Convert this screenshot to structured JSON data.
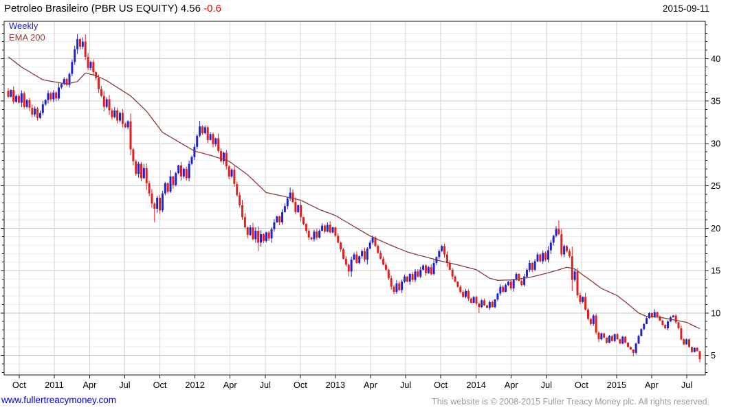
{
  "header": {
    "title_main": "Petroleo Brasileiro (PBR US EQUITY) 4.56 ",
    "title_change": "-0.6",
    "date": "2015-09-11"
  },
  "legend": {
    "weekly": "Weekly",
    "ema": "EMA 200"
  },
  "footer": {
    "site": "www.fullertreacymoney.com",
    "copyright": "This website is © 2008-2015 Fuller Treacy Money plc. All rights reserved."
  },
  "colors": {
    "up_candle": "#2222cc",
    "down_candle": "#e02020",
    "ema_line": "#8b3a3a",
    "change_text": "#e00000",
    "grid_minor": "#ececec",
    "grid_major": "#c9c9c9",
    "grid_vertical": "#d6d6d6",
    "axis": "#1a1a1a",
    "label_text": "#000000"
  },
  "chart_data": {
    "type": "candlestick",
    "interval": "weekly",
    "title": "Petroleo Brasileiro (PBR US EQUITY)",
    "last_price": 4.56,
    "change": -0.6,
    "as_of_date": "2015-09-11",
    "ylim": [
      2.7,
      44.4
    ],
    "y_major_ticks": [
      5,
      10,
      15,
      20,
      25,
      30,
      35,
      40
    ],
    "y_minor_step": 1,
    "y_minor_range": [
      3,
      44
    ],
    "x_tick_labels": [
      "Oct",
      "2011",
      "Apr",
      "Jul",
      "Oct",
      "2012",
      "Apr",
      "Jul",
      "Oct",
      "2013",
      "Apr",
      "Jul",
      "Oct",
      "2014",
      "Apr",
      "Jul",
      "Oct",
      "2015",
      "Apr",
      "Jul"
    ],
    "x_tick_weeks": [
      4.1,
      17.3,
      30.6,
      43.8,
      57.0,
      70.2,
      83.4,
      96.6,
      109.8,
      123.0,
      136.2,
      149.4,
      162.6,
      175.9,
      189.1,
      202.3,
      215.5,
      228.7,
      241.9,
      255.1
    ],
    "first_open": 36.2,
    "weekly_closes": [
      35.5,
      36.3,
      34.9,
      35.6,
      34.8,
      35.9,
      34.3,
      35.1,
      34.2,
      33.4,
      34.1,
      33.0,
      33.6,
      34.6,
      35.1,
      35.9,
      35.2,
      36.0,
      35.3,
      36.6,
      37.0,
      37.6,
      36.9,
      38.2,
      39.6,
      41.1,
      42.3,
      41.4,
      42.0,
      40.2,
      38.9,
      39.6,
      38.4,
      37.7,
      36.4,
      35.6,
      34.3,
      35.2,
      33.9,
      33.1,
      33.9,
      32.7,
      33.6,
      32.3,
      31.9,
      32.6,
      29.3,
      27.9,
      26.4,
      27.6,
      25.9,
      27.1,
      25.3,
      24.1,
      22.9,
      22.3,
      23.6,
      22.1,
      24.1,
      25.3,
      24.3,
      26.1,
      25.1,
      26.5,
      27.4,
      26.1,
      27.0,
      25.9,
      27.6,
      28.4,
      29.6,
      30.9,
      32.0,
      31.2,
      31.9,
      30.4,
      31.1,
      29.9,
      30.6,
      29.1,
      27.9,
      28.9,
      27.3,
      26.1,
      26.9,
      25.2,
      23.9,
      22.7,
      21.3,
      20.1,
      19.2,
      20.1,
      18.7,
      19.7,
      18.3,
      19.3,
      18.5,
      19.5,
      18.8,
      19.9,
      20.7,
      21.4,
      20.7,
      21.9,
      22.6,
      23.5,
      24.2,
      23.1,
      21.9,
      22.7,
      21.3,
      20.5,
      19.7,
      18.9,
      18.7,
      19.6,
      18.9,
      19.7,
      20.3,
      19.6,
      20.4,
      19.5,
      20.1,
      19.1,
      18.3,
      17.5,
      16.4,
      15.7,
      14.9,
      16.3,
      16.9,
      15.9,
      16.7,
      17.3,
      16.3,
      17.6,
      18.3,
      18.9,
      17.9,
      17.1,
      16.4,
      15.7,
      15.1,
      14.1,
      13.1,
      12.5,
      13.5,
      12.7,
      13.7,
      14.3,
      13.7,
      14.6,
      13.9,
      14.9,
      14.3,
      15.1,
      15.6,
      14.7,
      15.4,
      14.6,
      15.9,
      16.6,
      17.3,
      17.9,
      16.9,
      15.9,
      15.1,
      14.3,
      13.7,
      13.1,
      12.5,
      11.9,
      12.6,
      11.7,
      11.2,
      11.9,
      11.1,
      10.7,
      11.5,
      10.9,
      10.6,
      11.3,
      10.7,
      11.6,
      12.3,
      13.1,
      12.5,
      13.3,
      13.7,
      12.9,
      13.9,
      14.6,
      13.8,
      13.3,
      14.3,
      15.1,
      15.9,
      15.1,
      16.1,
      16.9,
      16.1,
      17.1,
      16.3,
      17.4,
      18.3,
      19.1,
      19.9,
      19.3,
      16.9,
      17.9,
      17.3,
      16.7,
      13.9,
      14.9,
      12.1,
      11.3,
      11.9,
      10.4,
      9.3,
      8.7,
      9.7,
      7.7,
      6.9,
      7.6,
      7.1,
      6.5,
      7.3,
      6.7,
      7.5,
      6.9,
      6.4,
      7.2,
      6.5,
      6.0,
      5.7,
      5.3,
      6.4,
      7.3,
      8.1,
      8.7,
      9.4,
      10.0,
      9.5,
      10.1,
      9.6,
      9.1,
      8.6,
      8.2,
      9.0,
      9.5,
      9.7,
      8.9,
      8.2,
      6.9,
      6.3,
      6.9,
      6.0,
      5.4,
      5.9,
      5.5,
      4.56
    ],
    "wick_overrides": {
      "26": [
        42.9,
        null
      ],
      "28": [
        42.5,
        null
      ],
      "46": [
        null,
        28.6
      ],
      "55": [
        null,
        20.7
      ],
      "72": [
        32.65,
        null
      ],
      "94": [
        null,
        17.3
      ],
      "106": [
        24.8,
        null
      ],
      "128": [
        null,
        14.3
      ],
      "145": [
        null,
        12.2
      ],
      "163": [
        18.05,
        null
      ],
      "177": [
        null,
        10.0
      ],
      "207": [
        20.9,
        null
      ],
      "222": [
        null,
        6.55
      ],
      "235": [
        null,
        4.9
      ],
      "243": [
        10.45,
        null
      ],
      "260": [
        null,
        4.2
      ]
    },
    "ema200_anchors": [
      [
        0,
        40.2
      ],
      [
        5,
        39.0
      ],
      [
        13,
        37.5
      ],
      [
        22,
        37.0
      ],
      [
        26,
        37.3
      ],
      [
        29,
        38.3
      ],
      [
        33,
        38.0
      ],
      [
        37,
        37.4
      ],
      [
        46,
        35.6
      ],
      [
        52,
        33.8
      ],
      [
        58,
        31.3
      ],
      [
        64,
        30.2
      ],
      [
        70,
        29.1
      ],
      [
        76,
        28.6
      ],
      [
        83,
        27.9
      ],
      [
        90,
        26.3
      ],
      [
        97,
        24.2
      ],
      [
        103,
        23.8
      ],
      [
        110,
        23.3
      ],
      [
        117,
        22.2
      ],
      [
        123,
        21.5
      ],
      [
        130,
        20.2
      ],
      [
        136,
        19.1
      ],
      [
        143,
        18.1
      ],
      [
        150,
        17.2
      ],
      [
        157,
        16.6
      ],
      [
        163,
        16.1
      ],
      [
        170,
        15.6
      ],
      [
        176,
        15.1
      ],
      [
        181,
        14.1
      ],
      [
        184,
        13.85
      ],
      [
        189,
        13.9
      ],
      [
        196,
        14.2
      ],
      [
        202,
        14.65
      ],
      [
        207,
        15.1
      ],
      [
        210,
        15.4
      ],
      [
        213,
        15.2
      ],
      [
        216,
        14.5
      ],
      [
        220,
        13.6
      ],
      [
        223,
        12.9
      ],
      [
        229,
        12.05
      ],
      [
        234,
        10.8
      ],
      [
        237,
        10.0
      ],
      [
        240,
        9.6
      ],
      [
        245,
        9.5
      ],
      [
        250,
        9.2
      ],
      [
        255,
        8.9
      ],
      [
        260,
        8.15
      ]
    ]
  }
}
